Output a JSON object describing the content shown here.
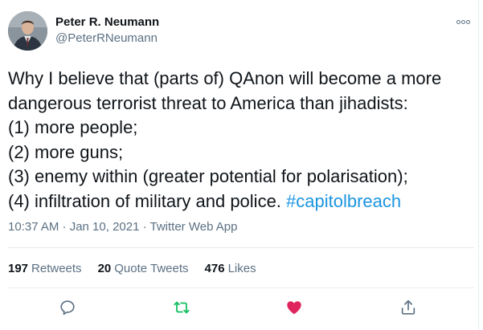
{
  "author": {
    "display_name": "Peter R. Neumann",
    "handle": "@PeterRNeumann",
    "avatar_icon": "profile-photo"
  },
  "tweet": {
    "lines": [
      "Why I believe that (parts of) QAnon will become a more",
      "dangerous terrorist threat to America than jihadists:",
      "(1) more people;",
      "(2) more guns;",
      "(3) enemy within (greater potential for polarisation);",
      "(4) infiltration of military and police. "
    ],
    "hashtag": "#capitolbreach"
  },
  "meta": {
    "text": "10:37 AM · Jan 10, 2021 · Twitter Web App"
  },
  "stats": {
    "retweets_count": "197",
    "retweets_label": "Retweets",
    "quotes_count": "20",
    "quotes_label": "Quote Tweets",
    "likes_count": "476",
    "likes_label": "Likes"
  },
  "actions": {
    "reply_icon": "reply-icon",
    "retweet_icon": "retweet-icon",
    "like_icon": "heart-icon",
    "share_icon": "share-icon"
  },
  "colors": {
    "accent": "#1b95e0",
    "retweet": "#17bf63",
    "like": "#e0245e",
    "secondary_text": "#5b7083",
    "border": "#e6ecf0"
  }
}
